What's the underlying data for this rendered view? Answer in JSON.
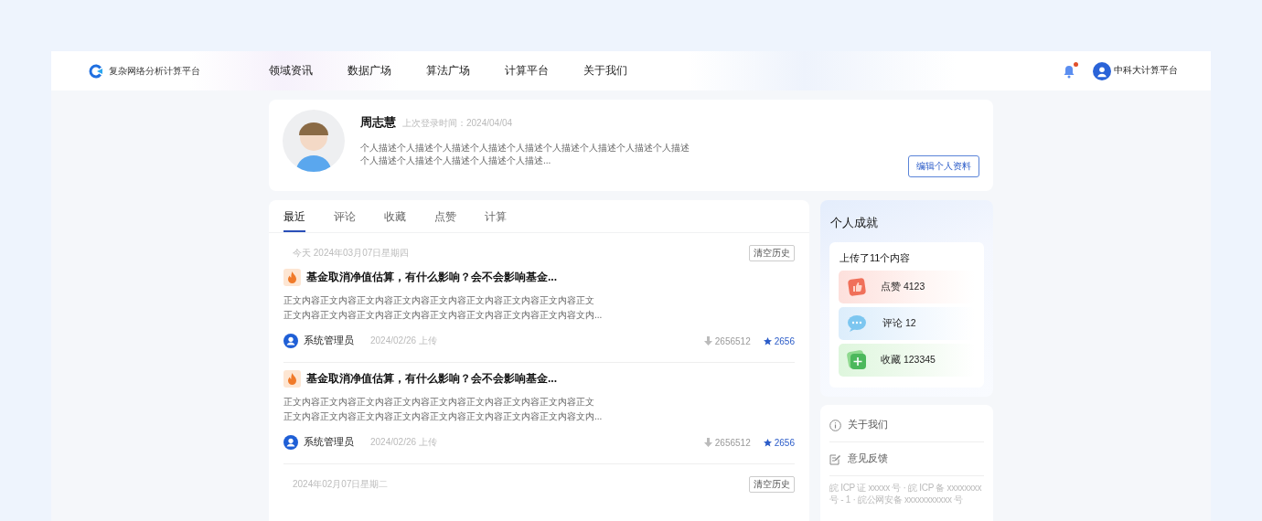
{
  "header": {
    "logo_text": "复杂网络分析计算平台",
    "nav": [
      "领域资讯",
      "数据广场",
      "算法广场",
      "计算平台",
      "关于我们"
    ],
    "notification_unread": true,
    "user_name": "中科大计算平台"
  },
  "profile": {
    "name": "周志慧",
    "last_login": "上次登录时间：2024/04/04",
    "description_lines": [
      "个人描述个人描述个人描述个人描述个人描述个人描述个人描述个人描述个人描述",
      "个人描述个人描述个人描述个人描述个人描述..."
    ],
    "edit_button": "编辑个人资料"
  },
  "tabs": [
    {
      "label": "最近",
      "selected": true
    },
    {
      "label": "评论",
      "selected": false
    },
    {
      "label": "收藏",
      "selected": false
    },
    {
      "label": "点赞",
      "selected": false
    },
    {
      "label": "计算",
      "selected": false
    }
  ],
  "feed": [
    {
      "date": "今天 2024年03月07日星期四",
      "clear_button": "清空历史",
      "posts": [
        {
          "title": "基金取消净值估算，有什么影响？会不会影响基金...",
          "body_lines": [
            "正文内容正文内容正文内容正文内容正文内容正文内容正文内容正文内容正文",
            "正文内容正文内容正文内容正文内容正文内容正文内容正文内容正文内容文内..."
          ],
          "author": "系统管理员",
          "uploaded": "2024/02/26 上传",
          "downloads": "2656512",
          "stars": "2656"
        },
        {
          "title": "基金取消净值估算，有什么影响？会不会影响基金...",
          "body_lines": [
            "正文内容正文内容正文内容正文内容正文内容正文内容正文内容正文内容正文",
            "正文内容正文内容正文内容正文内容正文内容正文内容正文内容正文内容文内..."
          ],
          "author": "系统管理员",
          "uploaded": "2024/02/26 上传",
          "downloads": "2656512",
          "stars": "2656"
        }
      ]
    },
    {
      "date": "2024年02月07日星期二",
      "clear_button": "清空历史"
    }
  ],
  "achievements": {
    "title": "个人成就",
    "summary": "上传了11个内容",
    "stats": [
      {
        "kind": "like",
        "label": "点赞 4123"
      },
      {
        "kind": "comment",
        "label": "评论 12"
      },
      {
        "kind": "favorite",
        "label": "收藏 123345"
      }
    ]
  },
  "links": [
    {
      "kind": "info",
      "label": "关于我们"
    },
    {
      "kind": "feedback",
      "label": "意见反馈"
    }
  ],
  "icp": "皖 ICP 证 xxxxx 号 · 皖 ICP 备 xxxxxxxx 号 - 1 · 皖公网安备 xxxxxxxxxxx 号"
}
